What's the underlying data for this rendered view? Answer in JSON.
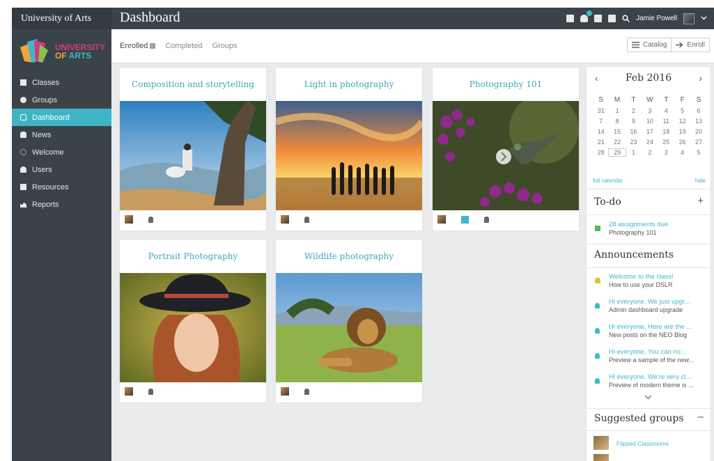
{
  "app": {
    "name": "University of Arts"
  },
  "header": {
    "title": "Dashboard",
    "user_name": "Jamie Powell",
    "icons": [
      "mail-icon",
      "notifications-icon",
      "calendar-icon",
      "help-icon",
      "search-icon"
    ]
  },
  "logo": {
    "line1": "UNIVERSITY",
    "line2a": "OF ",
    "line2b": "ARTS"
  },
  "sidebar": {
    "items": [
      {
        "label": "Classes",
        "icon": "classes-icon"
      },
      {
        "label": "Groups",
        "icon": "groups-icon"
      },
      {
        "label": "Dashboard",
        "icon": "dashboard-icon",
        "active": true
      },
      {
        "label": "News",
        "icon": "news-icon"
      },
      {
        "label": "Welcome",
        "icon": "welcome-icon"
      },
      {
        "label": "Users",
        "icon": "users-icon"
      },
      {
        "label": "Resources",
        "icon": "resources-icon"
      },
      {
        "label": "Reports",
        "icon": "reports-icon"
      }
    ]
  },
  "tabs": [
    {
      "label": "Enrolled",
      "active": true
    },
    {
      "label": "Completed"
    },
    {
      "label": "Groups"
    }
  ],
  "actions": {
    "catalog": "Catalog",
    "enroll": "Enroll"
  },
  "classes": [
    {
      "title": "Composition and storytelling"
    },
    {
      "title": "Light in photography"
    },
    {
      "title": "Photography 101"
    },
    {
      "title": "Portrait Photography"
    },
    {
      "title": "Wildlife photography"
    }
  ],
  "calendar": {
    "month": "Feb 2016",
    "weekdays": [
      "S",
      "M",
      "T",
      "W",
      "T",
      "F",
      "S"
    ],
    "weeks": [
      [
        "31",
        "1",
        "2",
        "3",
        "4",
        "5",
        "6"
      ],
      [
        "7",
        "8",
        "9",
        "10",
        "11",
        "12",
        "13"
      ],
      [
        "14",
        "15",
        "16",
        "17",
        "18",
        "19",
        "20"
      ],
      [
        "21",
        "22",
        "23",
        "24",
        "25",
        "26",
        "27"
      ],
      [
        "28",
        "29",
        "1",
        "2",
        "3",
        "4",
        "5"
      ]
    ],
    "full_calendar": "full calendar",
    "hide": "hide"
  },
  "todo": {
    "title": "To-do",
    "items": [
      {
        "title": "28 assignments due",
        "subtitle": "Photography 101"
      }
    ]
  },
  "announcements": {
    "title": "Announcements",
    "items": [
      {
        "title": "Welcome to the class!",
        "subtitle": "How to use your DSLR"
      },
      {
        "title": "Hi everyone, We just upgr...",
        "subtitle": "Admin dashboard upgrade"
      },
      {
        "title": "Hi everyone, Here are the ...",
        "subtitle": "New posts on the NEO Blog"
      },
      {
        "title": "Hi everyone, You can no...",
        "subtitle": "Preview a sample of the new..."
      },
      {
        "title": "Hi everyone, We're very cl...",
        "subtitle": "Preview of modern theme is ..."
      }
    ]
  },
  "suggested_groups": {
    "title": "Suggested groups",
    "items": [
      {
        "label": "Flipped Classrooms"
      }
    ]
  }
}
